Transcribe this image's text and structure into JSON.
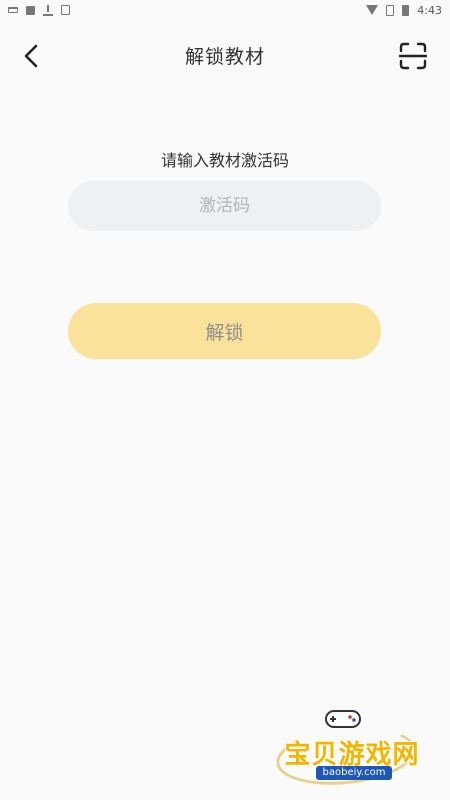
{
  "status_bar": {
    "time": "4:43",
    "left_icons": [
      "message-icon",
      "image-icon",
      "download-icon",
      "box-icon"
    ],
    "right_icons": [
      "wifi-icon",
      "sim-icon",
      "battery-icon"
    ]
  },
  "header": {
    "title": "解锁教材",
    "back_icon": "chevron-left-icon",
    "scan_icon": "scan-icon"
  },
  "form": {
    "prompt": "请输入教材激活码",
    "code_value": "",
    "code_placeholder": "激活码",
    "unlock_label": "解锁"
  },
  "watermark": {
    "text": "宝贝游戏网",
    "url": "baobeiy.com"
  },
  "colors": {
    "background": "#fafafa",
    "input_bg": "#eef0f2",
    "button_bg": "#fbe29a",
    "button_text": "#8e8e8e",
    "watermark_text": "#f4b400",
    "watermark_url_bg": "#1e57b8"
  }
}
